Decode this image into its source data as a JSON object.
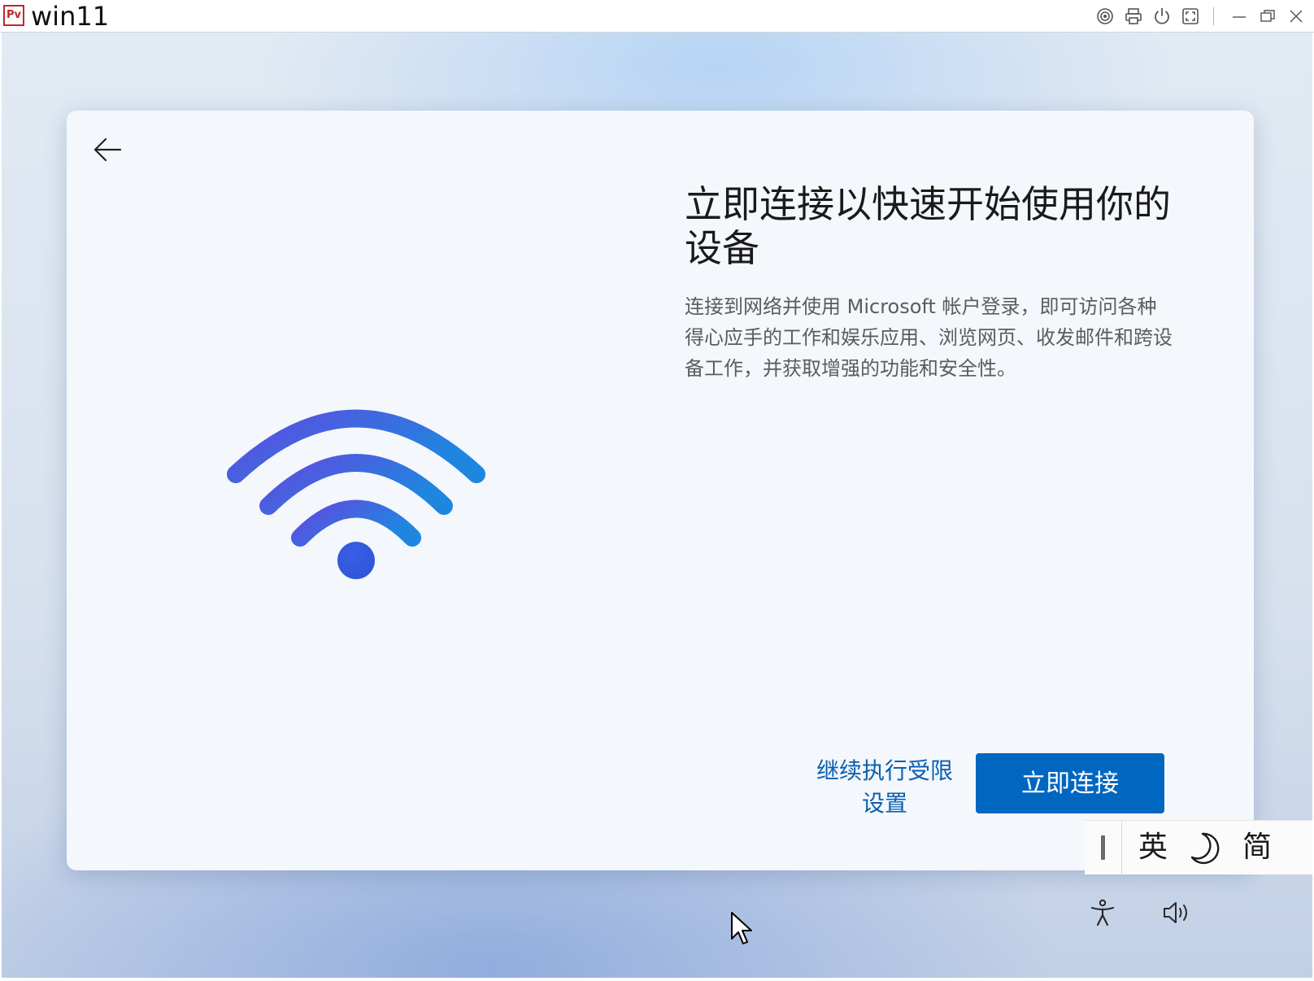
{
  "window": {
    "logo_text": "Pv",
    "title": "win11",
    "toolbar_icons": [
      "target-icon",
      "printer-icon",
      "power-icon",
      "fullscreen-icon",
      "minimize-icon",
      "restore-icon",
      "close-icon"
    ]
  },
  "oobe": {
    "heading": "立即连接以快速开始使用你的设备",
    "description": "连接到网络并使用 Microsoft 帐户登录，即可访问各种得心应手的工作和娱乐应用、浏览网页、收发邮件和跨设备工作，并获取增强的功能和安全性。",
    "limited_setup_label_line1": "继续执行受限",
    "limited_setup_label_line2": "设置",
    "connect_now_label": "立即连接",
    "illustration": "wifi-icon",
    "accent_color": "#0067c0"
  },
  "ime_bar": {
    "mode": "英",
    "script": "简"
  },
  "tray": {
    "icons": [
      "accessibility-icon",
      "volume-icon"
    ]
  }
}
